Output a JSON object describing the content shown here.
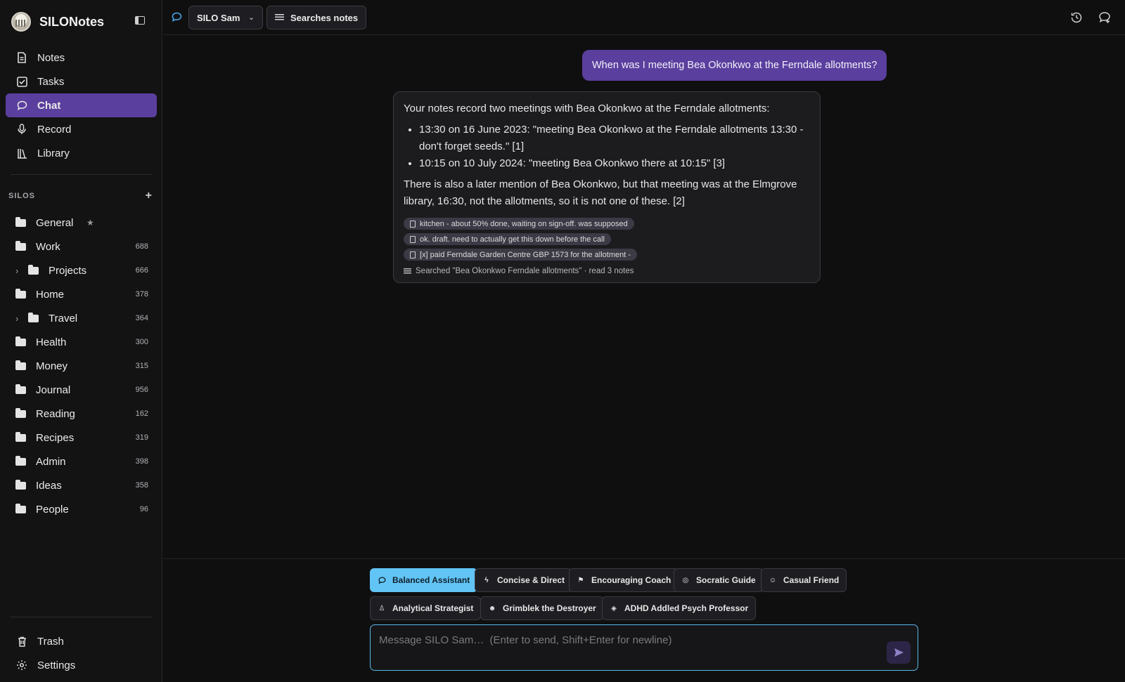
{
  "app": {
    "name": "SILONotes"
  },
  "nav": [
    {
      "label": "Notes",
      "icon": "notes-icon"
    },
    {
      "label": "Tasks",
      "icon": "tasks-icon"
    },
    {
      "label": "Chat",
      "icon": "chat-icon",
      "active": true
    },
    {
      "label": "Record",
      "icon": "microphone-icon"
    },
    {
      "label": "Library",
      "icon": "library-icon"
    }
  ],
  "silos": {
    "title": "SILOS",
    "add_label": "+",
    "items": [
      {
        "label": "General",
        "count": "",
        "star": "★"
      },
      {
        "label": "Work",
        "count": "688"
      },
      {
        "label": "Projects",
        "count": "666",
        "child": true
      },
      {
        "label": "Home",
        "count": "378"
      },
      {
        "label": "Travel",
        "count": "364",
        "child": true
      },
      {
        "label": "Health",
        "count": "300"
      },
      {
        "label": "Money",
        "count": "315"
      },
      {
        "label": "Journal",
        "count": "956"
      },
      {
        "label": "Reading",
        "count": "162"
      },
      {
        "label": "Recipes",
        "count": "319"
      },
      {
        "label": "Admin",
        "count": "398"
      },
      {
        "label": "Ideas",
        "count": "358"
      },
      {
        "label": "People",
        "count": "96"
      }
    ]
  },
  "bottom_nav": [
    {
      "label": "Trash"
    },
    {
      "label": "Settings"
    }
  ],
  "topbar": {
    "assistant_select": "SILO Sam",
    "mode_pill": "Searches notes"
  },
  "conversation": {
    "user_message": "When was I meeting Bea Okonkwo at the Ferndale allotments?",
    "assistant": {
      "intro": "Your notes record two meetings with Bea Okonkwo at the Ferndale allotments:",
      "bullets": [
        "13:30 on 16 June 2023: \"meeting Bea Okonkwo at the Ferndale allotments 13:30 - don't forget seeds.\" [1]",
        "10:15 on 10 July 2024: \"meeting Bea Okonkwo there at 10:15\" [3]"
      ],
      "outro": "There is also a later mention of Bea Okonkwo, but that meeting was at the Elmgrove library, 16:30, not the allotments, so it is not one of these. [2]",
      "references": [
        "kitchen - about 50% done, waiting on sign-off. was supposed",
        "ok. draft. need to actually get this down before the call",
        "[x] paid Ferndale Garden Centre GBP 1573 for the allotment -"
      ],
      "search_summary": "Searched \"Bea Okonkwo Ferndale allotments\" · read 3 notes"
    }
  },
  "personas": [
    {
      "label": "Balanced Assistant",
      "active": true
    },
    {
      "label": "Concise & Direct"
    },
    {
      "label": "Encouraging Coach"
    },
    {
      "label": "Socratic Guide"
    },
    {
      "label": "Casual Friend"
    },
    {
      "label": "Analytical Strategist"
    },
    {
      "label": "Grimblek the Destroyer"
    },
    {
      "label": "ADHD Addled Psych Professor"
    }
  ],
  "composer": {
    "placeholder": "Message SILO Sam…  (Enter to send, Shift+Enter for newline)",
    "value": ""
  },
  "colors": {
    "accent_purple": "#5b3f9e",
    "active_persona": "#62c4f5",
    "background": "#0f0f10"
  }
}
